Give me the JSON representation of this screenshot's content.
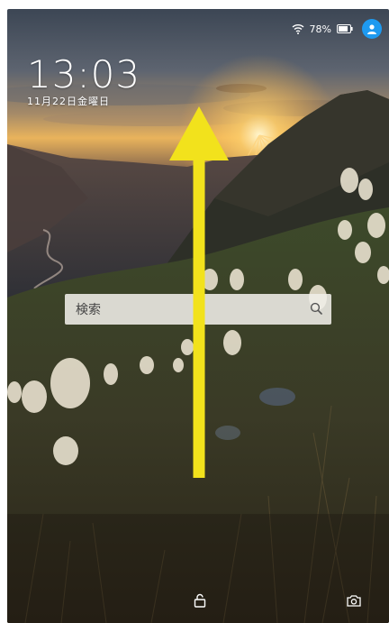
{
  "status": {
    "battery_text": "78%",
    "icons": [
      "wifi-icon",
      "battery-icon",
      "account-icon"
    ],
    "accent_color": "#1e9af0"
  },
  "lockscreen": {
    "time": "13:03",
    "date": "11月22日金曜日"
  },
  "search": {
    "label": "検索",
    "icon": "search-icon"
  },
  "gesture": {
    "direction": "swipe-up",
    "arrow_color": "#f2e21c"
  },
  "bottom_bar": {
    "left_icon": "unlock-icon",
    "right_icon": "camera-icon"
  }
}
